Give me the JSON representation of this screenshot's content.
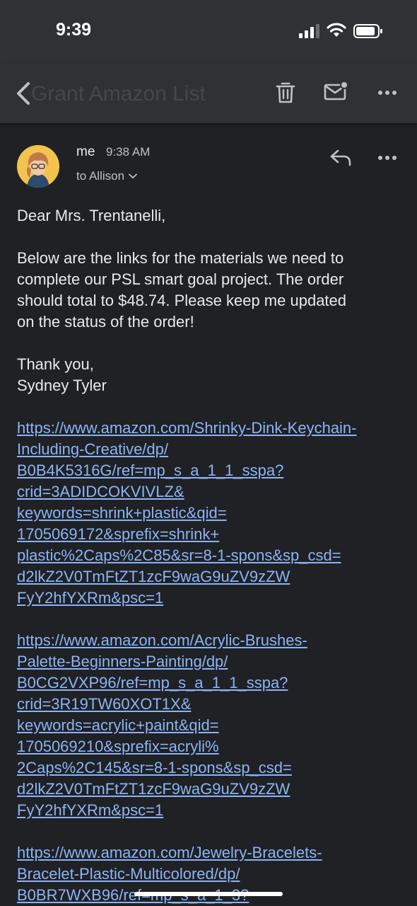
{
  "status_bar": {
    "time": "9:39"
  },
  "top_bar": {
    "subject": "Grant Amazon List"
  },
  "message": {
    "sender": "me",
    "time": "9:38 AM",
    "recipient": "to Allison",
    "greeting": "Dear Mrs. Trentanelli,",
    "paragraph": [
      "Below are the links for the materials we need to",
      "complete our PSL smart goal project. The order",
      "should total to $48.74. Please keep me updated",
      "on the status of the order!"
    ],
    "signoff": [
      "Thank you,",
      "Sydney Tyler"
    ],
    "links": [
      [
        "https://www.amazon.com/Shrinky-Dink-Keychain-",
        "Including-Creative/dp/",
        "B0B4K5316G/ref=mp_s_a_1_1_sspa?",
        "crid=3ADIDCOKVIVLZ&",
        "keywords=shrink+plastic&qid=",
        "1705069172&sprefix=shrink+",
        "plastic%2Caps%2C85&sr=8-1-spons&sp_csd=",
        "d2lkZ2V0TmFtZT1zcF9waG9uZV9zZW",
        "FyY2hfYXRm&psc=1"
      ],
      [
        "https://www.amazon.com/Acrylic-Brushes-",
        "Palette-Beginners-Painting/dp/",
        "B0CG2VXP96/ref=mp_s_a_1_1_sspa?",
        "crid=3R19TW60XOT1X&",
        "keywords=acrylic+paint&qid=",
        "1705069210&sprefix=acryli%",
        "2Caps%2C145&sr=8-1-spons&sp_csd=",
        "d2lkZ2V0TmFtZT1zcF9waG9uZV9zZW",
        "FyY2hfYXRm&psc=1"
      ],
      [
        "https://www.amazon.com/Jewelry-Bracelets-",
        "Bracelet-Plastic-Multicolored/dp/",
        "B0BR7WXB96/ref=mp_s_a_1_3?"
      ]
    ]
  }
}
